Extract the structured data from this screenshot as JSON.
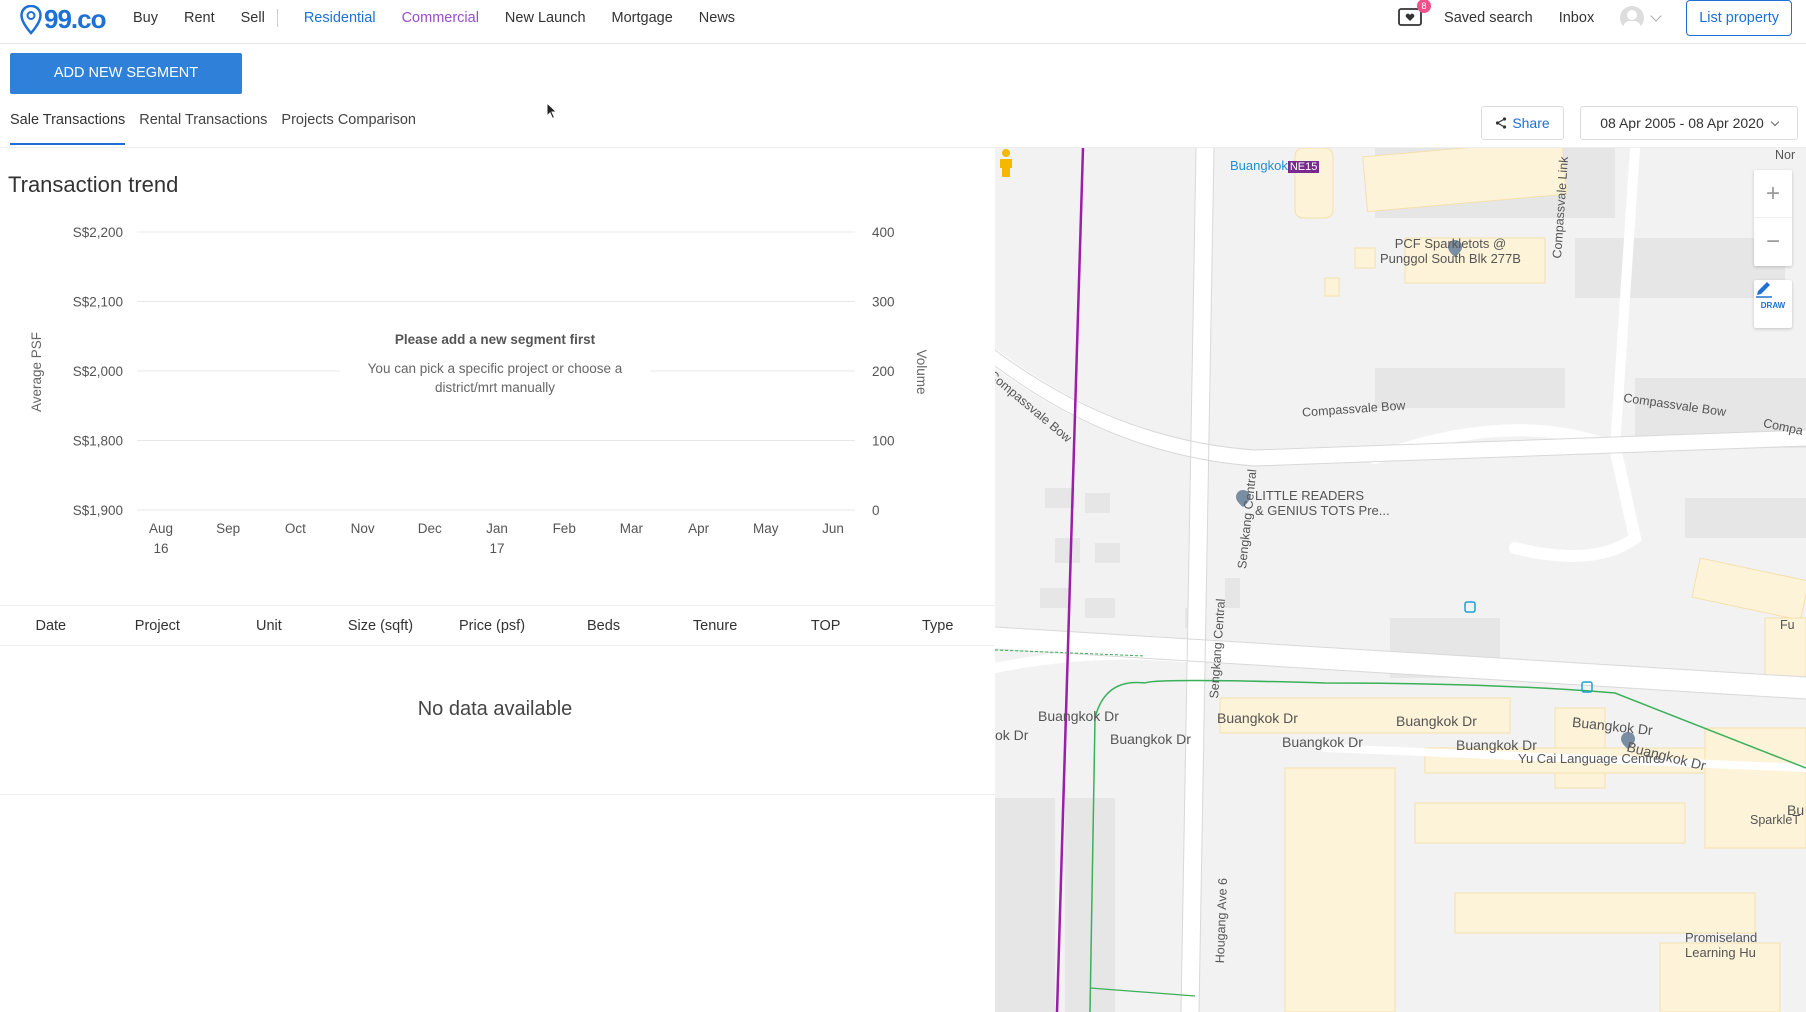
{
  "brand": {
    "name": "99.co",
    "color": "#1d70d6"
  },
  "nav": {
    "buy": "Buy",
    "rent": "Rent",
    "sell": "Sell",
    "residential": "Residential",
    "commercial": "Commercial",
    "new_launch": "New Launch",
    "mortgage": "Mortgage",
    "news": "News"
  },
  "header": {
    "cart_badge": "8",
    "saved_search": "Saved search",
    "inbox": "Inbox",
    "list_property": "List property"
  },
  "actions": {
    "add_segment": "ADD NEW SEGMENT",
    "share": "Share",
    "date_range": "08 Apr 2005 - 08 Apr 2020"
  },
  "tabs": [
    "Sale Transactions",
    "Rental Transactions",
    "Projects Comparison"
  ],
  "trend": {
    "title": "Transaction trend",
    "empty_title": "Please add a new segment first",
    "empty_subtitle": "You can pick a specific project or choose a district/mrt manually"
  },
  "chart_data": {
    "type": "line",
    "title": "",
    "ylabel": "Average PSF",
    "y2label": "Volume",
    "y_ticks": [
      "S$2,200",
      "S$2,100",
      "S$2,000",
      "S$1,800",
      "S$1,900"
    ],
    "y2_ticks": [
      "400",
      "300",
      "200",
      "100",
      "0"
    ],
    "x_ticks": [
      [
        "Aug",
        "16"
      ],
      [
        "Sep",
        ""
      ],
      [
        "Oct",
        ""
      ],
      [
        "Nov",
        ""
      ],
      [
        "Dec",
        ""
      ],
      [
        "Jan",
        "17"
      ],
      [
        "Feb",
        ""
      ],
      [
        "Mar",
        ""
      ],
      [
        "Apr",
        ""
      ],
      [
        "May",
        ""
      ],
      [
        "Jun",
        ""
      ]
    ],
    "series": [],
    "grid": true
  },
  "table": {
    "columns": [
      "Date",
      "Project",
      "Unit",
      "Size (sqft)",
      "Price (psf)",
      "Beds",
      "Tenure",
      "TOP",
      "Type"
    ],
    "empty": "No data available"
  },
  "map": {
    "station": "Buangkok",
    "station_code": "NE15",
    "labels": {
      "sparkletots": "PCF Sparkletots @ Punggol South Blk 277B",
      "sparkletots_l1": "PCF Sparkletots @",
      "sparkletots_l2": "Punggol South Blk 277B",
      "little_readers_l1": "LITTLE READERS",
      "little_readers_l2": "& GENIUS TOTS Pre...",
      "yu_cai": "Yu Cai Language Centre",
      "compassvale_bow": "Compassvale Bow",
      "compassvale_link": "Compassvale Link",
      "buangkok_dr": "Buangkok Dr",
      "sengkang_central": "Sengkang Central",
      "hougang_ave6": "Hougang Ave 6",
      "promiseland_l1": "Promiseland",
      "promiseland_l2": "Learning Hu",
      "sparklet": "SparkleT",
      "fu": "Fu",
      "bu": "Bu",
      "compa": "Compa",
      "nor": "Nor",
      "ok_dr": "ok Dr"
    },
    "draw_label": "DRAW"
  }
}
